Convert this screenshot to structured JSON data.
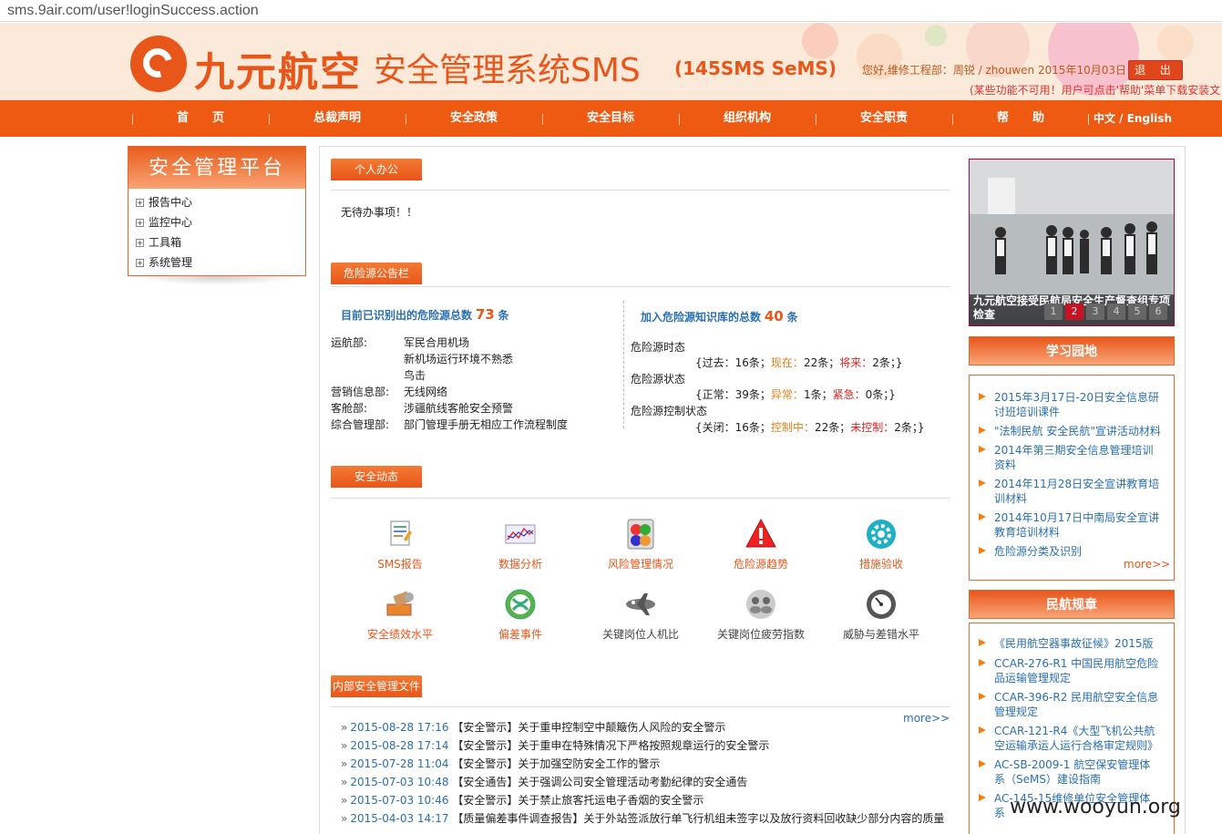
{
  "browser": {
    "url": "sms.9air.com/user!loginSuccess.action"
  },
  "header": {
    "brand": "九元航空",
    "system_name": "安全管理系统SMS",
    "system_code": "(145SMS SeMS)",
    "greeting": "您好,维修工程部：周锐 / zhouwen 2015年10月03日",
    "logout_label": "退 出",
    "notice": "(某些功能不可用！用户可点击'帮助'菜单下载安装文"
  },
  "nav": {
    "items": [
      "首　　页",
      "总裁声明",
      "安全政策",
      "安全目标",
      "组织机构",
      "安全职责",
      "帮　　助"
    ],
    "language": "中文 / English"
  },
  "sidebar": {
    "title": "安全管理平台",
    "items": [
      "报告中心",
      "监控中心",
      "工具箱",
      "系统管理"
    ]
  },
  "personal": {
    "tab": "个人办公",
    "message": "无待办事项！！"
  },
  "hazard": {
    "tab": "危险源公告栏",
    "identified_prefix": "目前已识别出的危险源总数",
    "identified_count": "73",
    "identified_suffix": "条",
    "entries": [
      {
        "dept": "运航部:",
        "items": [
          "军民合用机场",
          "新机场运行环境不熟悉",
          "鸟击"
        ]
      },
      {
        "dept": "营销信息部:",
        "items": [
          "无线网络"
        ]
      },
      {
        "dept": "客舱部:",
        "items": [
          "涉疆航线客舱安全预警"
        ]
      },
      {
        "dept": "综合管理部:",
        "items": [
          "部门管理手册无相应工作流程制度"
        ]
      }
    ],
    "kb_prefix": "加入危险源知识库的总数",
    "kb_count": "40",
    "kb_suffix": "条",
    "tense_label": "危险源时态",
    "tense": {
      "open": "{过去：",
      "a_val": "16条；",
      "b_lbl": "现在：",
      "b_val": "22条；",
      "c_lbl": "将来：",
      "c_val": "2条；}"
    },
    "state_label": "危险源状态",
    "state": {
      "open": "{正常：",
      "a_val": "39条；",
      "b_lbl": "异常：",
      "b_val": "1条；",
      "c_lbl": "紧急：",
      "c_val": "0条；}"
    },
    "control_label": "危险源控制状态",
    "control": {
      "open": "{关闭：",
      "a_val": "16条；",
      "b_lbl": "控制中：",
      "b_val": "22条；",
      "c_lbl": "未控制：",
      "c_val": "2条；}"
    }
  },
  "dynamics": {
    "tab": "安全动态",
    "items": [
      {
        "label": "SMS报告",
        "icon": "report-icon"
      },
      {
        "label": "数据分析",
        "icon": "chart-icon"
      },
      {
        "label": "风险管理情况",
        "icon": "risk-icon"
      },
      {
        "label": "危险源趋势",
        "icon": "warning-icon"
      },
      {
        "label": "措施验收",
        "icon": "gear-icon"
      },
      {
        "label": "安全绩效水平",
        "icon": "tools-icon"
      },
      {
        "label": "偏差事件",
        "icon": "deviation-icon"
      },
      {
        "label": "关键岗位人机比",
        "icon": "airplane-icon"
      },
      {
        "label": "关键岗位疲劳指数",
        "icon": "people-icon"
      },
      {
        "label": "威胁与差错水平",
        "icon": "gauge-icon"
      }
    ]
  },
  "documents": {
    "tab": "内部安全管理文件",
    "more": "more>>",
    "rows": [
      {
        "date": "2015-08-28 17:16",
        "text": "【安全警示】关于重申控制空中颠簸伤人风险的安全警示"
      },
      {
        "date": "2015-08-28 17:14",
        "text": "【安全警示】关于重申在特殊情况下严格按照规章运行的安全警示"
      },
      {
        "date": "2015-07-28 11:04",
        "text": "【安全警示】关于加强空防安全工作的警示"
      },
      {
        "date": "2015-07-03 10:48",
        "text": "【安全通告】关于强调公司安全管理活动考勤纪律的安全通告"
      },
      {
        "date": "2015-07-03 10:46",
        "text": "【安全警示】关于禁止旅客托运电子香烟的安全警示"
      },
      {
        "date": "2015-04-03 14:17",
        "text": "【质量偏差事件调查报告】关于外站签派放行单飞行机组未签字以及放行资料回收缺少部分内容的质量"
      }
    ]
  },
  "news_photo": {
    "caption": "九元航空接受民航局安全生产督查组专项检查",
    "pages": [
      "1",
      "2",
      "3",
      "4",
      "5",
      "6"
    ]
  },
  "learning": {
    "title": "学习园地",
    "items": [
      "2015年3月17日-20日安全信息研讨班培训课件",
      "\"法制民航 安全民航\"宣讲活动材料",
      "2014年第三期安全信息管理培训资料",
      "2014年11月28日安全宣讲教育培训材料",
      "2014年10月17日中南局安全宣讲教育培训材料",
      "危险源分类及识别"
    ],
    "more": "more>>"
  },
  "regulations": {
    "title": "民航规章",
    "items": [
      "《民用航空器事故征候》2015版",
      "CCAR-276-R1 中国民用航空危险品运输管理规定",
      "CCAR-396-R2 民用航空安全信息管理规定",
      "CCAR-121-R4《大型飞机公共航空运输承运人运行合格审定规则》",
      "AC-SB-2009-1 航空保安管理体系（SeMS）建设指南",
      "AC-145-15维修单位安全管理体系"
    ]
  },
  "watermark": "www.wooyun.org",
  "colors": {
    "accent": "#ee5a12",
    "link": "#2a6fb0",
    "alert": "#d22222"
  }
}
